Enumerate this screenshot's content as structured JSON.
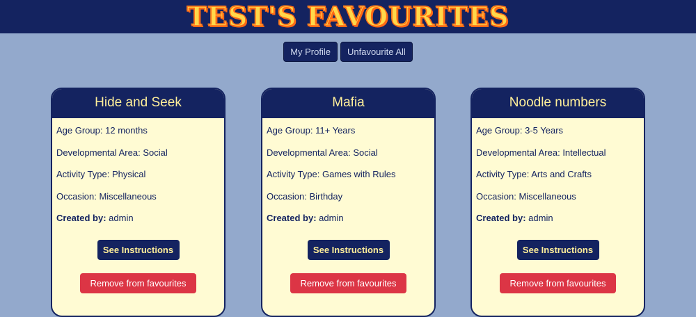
{
  "header": {
    "title": "TEST'S FAVOURITES"
  },
  "nav": {
    "my_profile": "My Profile",
    "unfavourite_all": "Unfavourite All"
  },
  "labels": {
    "age_group": "Age Group:",
    "developmental_area": "Developmental Area:",
    "activity_type": "Activity Type:",
    "occasion": "Occasion:",
    "created_by": "Created by:",
    "see_instructions": "See Instructions",
    "remove_favourite": "Remove from favourites"
  },
  "cards": [
    {
      "title": "Hide and Seek",
      "age_group": "12 months",
      "developmental_area": "Social",
      "activity_type": "Physical",
      "occasion": "Miscellaneous",
      "created_by": "admin"
    },
    {
      "title": "Mafia",
      "age_group": "11+ Years",
      "developmental_area": "Social",
      "activity_type": "Games with Rules",
      "occasion": "Birthday",
      "created_by": "admin"
    },
    {
      "title": "Noodle numbers",
      "age_group": "3-5 Years",
      "developmental_area": "Intellectual",
      "activity_type": "Arts and Crafts",
      "occasion": "Miscellaneous",
      "created_by": "admin"
    }
  ]
}
